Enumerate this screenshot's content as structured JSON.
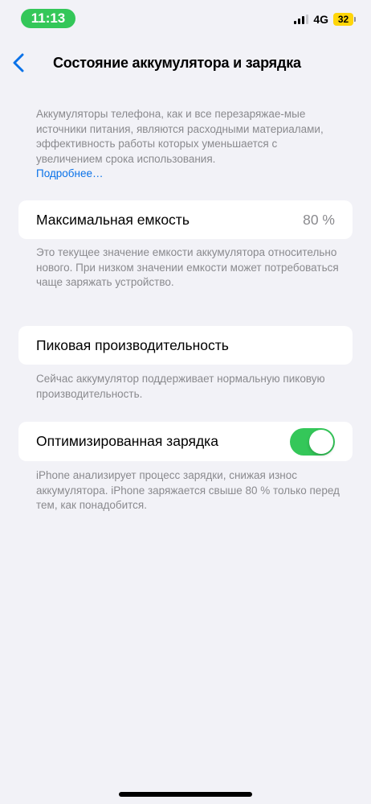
{
  "status_bar": {
    "time": "11:13",
    "network": "4G",
    "battery_level": "32",
    "time_pill_color": "#34c759",
    "battery_color": "#ffd60a"
  },
  "nav": {
    "back_icon": "chevron-left-icon",
    "title": "Состояние аккумулятора и зарядка"
  },
  "intro": {
    "text": "Аккумуляторы телефона, как и все перезаряжае-мые источники питания, являются расходными материалами, эффективность работы которых уменьшается с увеличением срока использования.",
    "link": "Подробнее…"
  },
  "max_capacity": {
    "label": "Максимальная емкость",
    "value": "80 %",
    "footnote": "Это текущее значение емкости аккумулятора относительно нового. При низком значении емкости может потребоваться чаще заряжать устройство."
  },
  "peak_performance": {
    "label": "Пиковая производительность",
    "footnote": "Сейчас аккумулятор поддерживает нормальную пиковую производительность."
  },
  "optimized_charging": {
    "label": "Оптимизированная зарядка",
    "enabled": true,
    "toggle_color": "#34c759",
    "footnote": "iPhone анализирует процесс зарядки, снижая износ аккумулятора. iPhone заряжается свыше 80 % только перед тем, как понадобится."
  },
  "accent_color": "#0a72e8"
}
